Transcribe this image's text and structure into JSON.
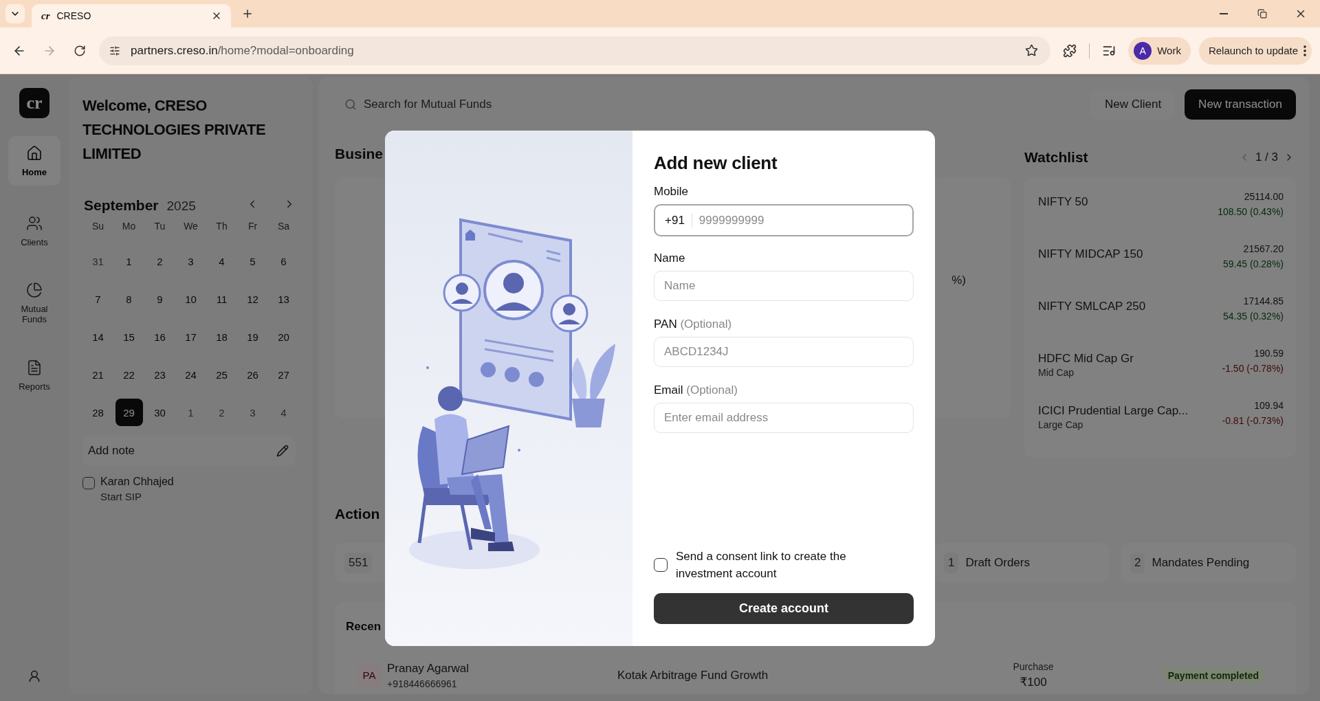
{
  "browser": {
    "tab_favicon": "cr",
    "tab_title": "CRESO",
    "url_host": "partners.creso.in",
    "url_path": "/home?modal=onboarding",
    "forward_disabled": true,
    "profile_initial": "A",
    "profile_name": "Work",
    "relaunch_label": "Relaunch to update"
  },
  "rail": {
    "logo": "cr",
    "items": [
      {
        "label": "Home",
        "selected": true
      },
      {
        "label": "Clients",
        "selected": false
      },
      {
        "label": "Mutual Funds",
        "selected": false
      },
      {
        "label": "Reports",
        "selected": false
      }
    ]
  },
  "welcome": "Welcome, CRESO TECHNOLOGIES PRIVATE LIMITED",
  "calendar": {
    "month": "September",
    "year": "2025",
    "weekdays": [
      "Su",
      "Mo",
      "Tu",
      "We",
      "Th",
      "Fr",
      "Sa"
    ],
    "weeks": [
      [
        {
          "day": "31",
          "muted": true,
          "selected": false
        },
        {
          "day": "1",
          "muted": false,
          "selected": false
        },
        {
          "day": "2",
          "muted": false,
          "selected": false
        },
        {
          "day": "3",
          "muted": false,
          "selected": false
        },
        {
          "day": "4",
          "muted": false,
          "selected": false
        },
        {
          "day": "5",
          "muted": false,
          "selected": false
        },
        {
          "day": "6",
          "muted": false,
          "selected": false
        }
      ],
      [
        {
          "day": "7",
          "muted": false,
          "selected": false
        },
        {
          "day": "8",
          "muted": false,
          "selected": false
        },
        {
          "day": "9",
          "muted": false,
          "selected": false
        },
        {
          "day": "10",
          "muted": false,
          "selected": false
        },
        {
          "day": "11",
          "muted": false,
          "selected": false
        },
        {
          "day": "12",
          "muted": false,
          "selected": false
        },
        {
          "day": "13",
          "muted": false,
          "selected": false
        }
      ],
      [
        {
          "day": "14",
          "muted": false,
          "selected": false
        },
        {
          "day": "15",
          "muted": false,
          "selected": false
        },
        {
          "day": "16",
          "muted": false,
          "selected": false
        },
        {
          "day": "17",
          "muted": false,
          "selected": false
        },
        {
          "day": "18",
          "muted": false,
          "selected": false
        },
        {
          "day": "19",
          "muted": false,
          "selected": false
        },
        {
          "day": "20",
          "muted": false,
          "selected": false
        }
      ],
      [
        {
          "day": "21",
          "muted": false,
          "selected": false
        },
        {
          "day": "22",
          "muted": false,
          "selected": false
        },
        {
          "day": "23",
          "muted": false,
          "selected": false
        },
        {
          "day": "24",
          "muted": false,
          "selected": false
        },
        {
          "day": "25",
          "muted": false,
          "selected": false
        },
        {
          "day": "26",
          "muted": false,
          "selected": false
        },
        {
          "day": "27",
          "muted": false,
          "selected": false
        }
      ],
      [
        {
          "day": "28",
          "muted": false,
          "selected": false
        },
        {
          "day": "29",
          "muted": false,
          "selected": true
        },
        {
          "day": "30",
          "muted": false,
          "selected": false
        },
        {
          "day": "1",
          "muted": true,
          "selected": false
        },
        {
          "day": "2",
          "muted": true,
          "selected": false
        },
        {
          "day": "3",
          "muted": true,
          "selected": false
        },
        {
          "day": "4",
          "muted": true,
          "selected": false
        }
      ]
    ]
  },
  "note": {
    "label": "Add note"
  },
  "tasks": [
    {
      "name": "Karan Chhajed",
      "detail": "Start SIP",
      "checked": false
    }
  ],
  "main": {
    "search_placeholder": "Search for Mutual Funds",
    "buttons": [
      {
        "label": "New Client",
        "kind": "secondary"
      },
      {
        "label": "New transaction",
        "kind": "primary"
      }
    ],
    "business": {
      "title": "Busine",
      "fragment": "%)"
    },
    "watchlist": {
      "title": "Watchlist",
      "page": "1 / 3",
      "prev_disabled": true,
      "items": [
        {
          "name": "NIFTY 50",
          "price": "25114.00",
          "change": "108.50 (0.43%)",
          "kind": "gain"
        },
        {
          "name": "NIFTY MIDCAP 150",
          "price": "21567.20",
          "change": "59.45 (0.28%)",
          "kind": "gain"
        },
        {
          "name": "NIFTY SMLCAP 250",
          "price": "17144.85",
          "change": "54.35 (0.32%)",
          "kind": "gain"
        },
        {
          "name": "HDFC Mid Cap Gr",
          "category": "Mid Cap",
          "price": "190.59",
          "change": "-1.50 (-0.78%)",
          "kind": "loss"
        },
        {
          "name": "ICICI Prudential Large Cap...",
          "category": "Large Cap",
          "price": "109.94",
          "change": "-0.81 (-0.73%)",
          "kind": "loss"
        }
      ]
    },
    "actions": {
      "title": "Action",
      "items": [
        {
          "count": "551"
        },
        {
          "count": "1",
          "label": "Draft Orders"
        },
        {
          "count": "2",
          "label": "Mandates Pending"
        }
      ]
    },
    "recent": {
      "title": "Recen",
      "rows": [
        {
          "initials": "PA",
          "name": "Pranay Agarwal",
          "phone": "+918446666961",
          "fund": "Kotak Arbitrage Fund Growth",
          "type": "Purchase",
          "amount": "₹100",
          "status": "Payment completed"
        }
      ]
    }
  },
  "modal": {
    "title": "Add new client",
    "fields": [
      {
        "label": "Mobile",
        "prefix": "+91",
        "placeholder": "9999999999",
        "focused": true
      },
      {
        "label": "Name",
        "placeholder": "Name",
        "focused": false
      },
      {
        "label": "PAN",
        "note": "(Optional)",
        "placeholder": "ABCD1234J",
        "focused": false
      },
      {
        "label": "Email",
        "note": "(Optional)",
        "placeholder": "Enter email address",
        "focused": false
      }
    ],
    "consent": {
      "label": "Send a consent link to create the investment account",
      "checked": false
    },
    "submit": "Create account"
  }
}
